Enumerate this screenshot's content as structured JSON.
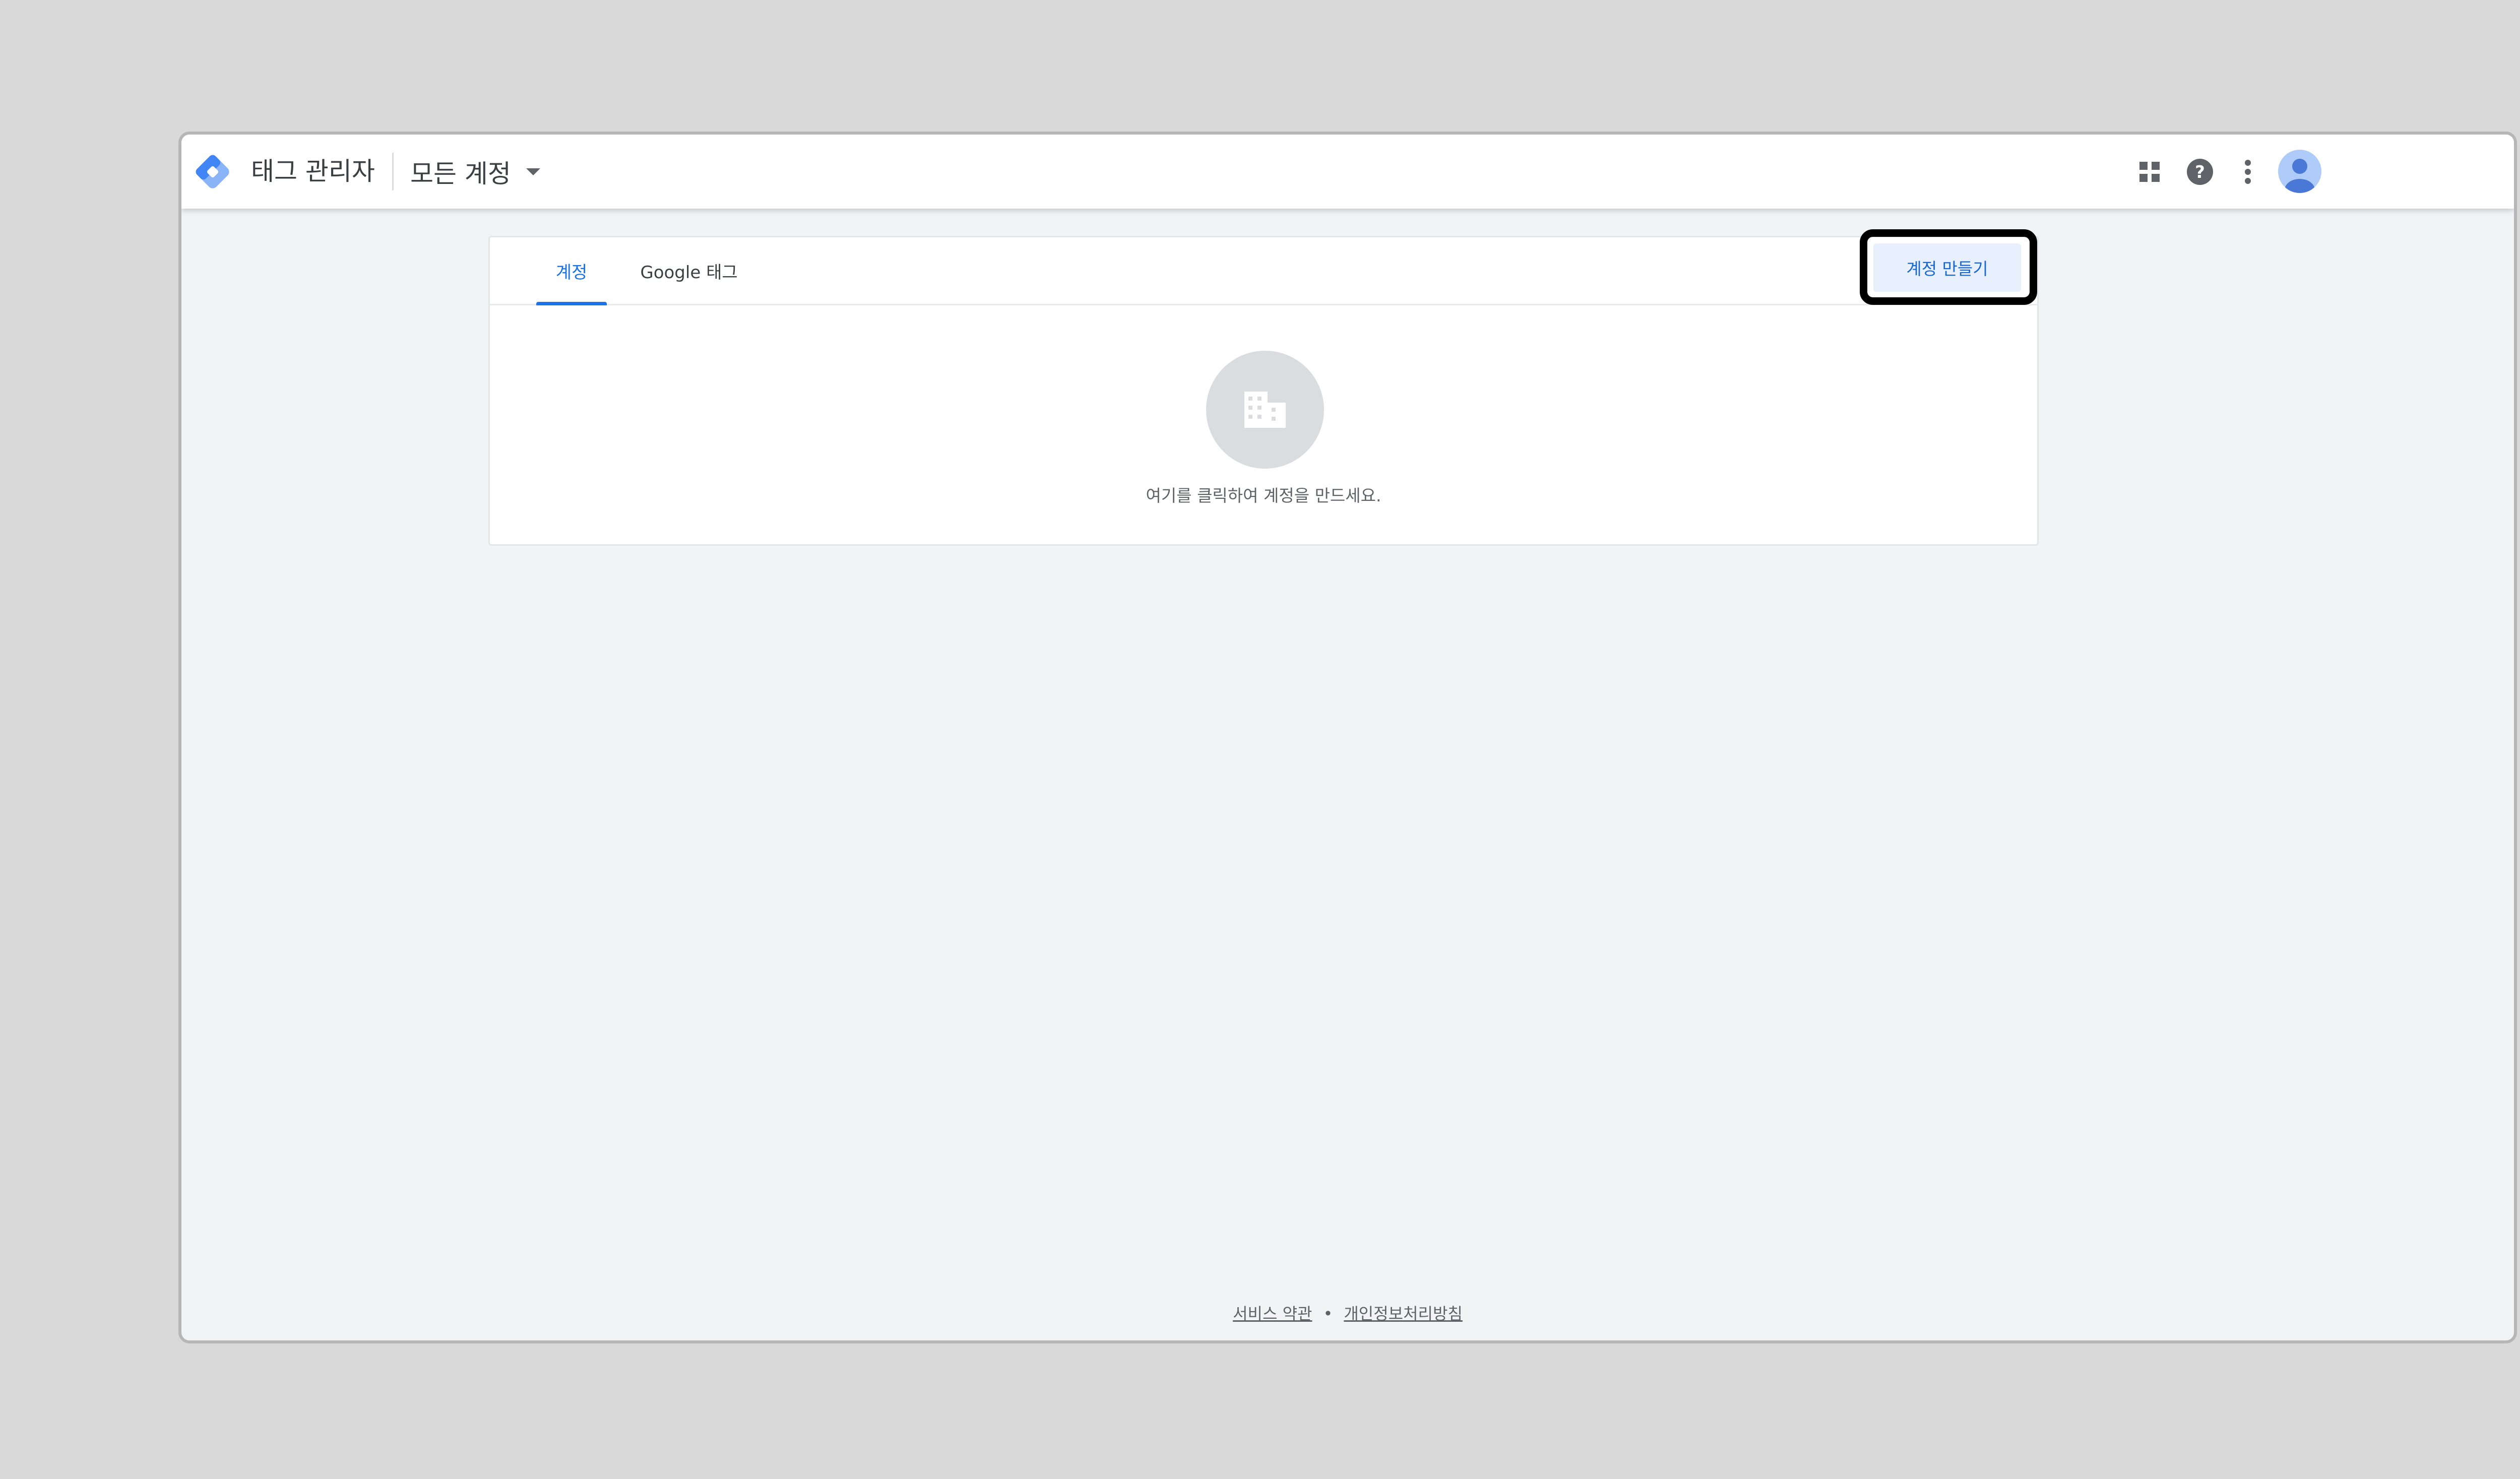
{
  "header": {
    "app_title": "태그 관리자",
    "account_switcher_label": "모든 계정"
  },
  "tabs": [
    {
      "label": "계정",
      "active": true
    },
    {
      "label": "Google 태그",
      "active": false
    }
  ],
  "create_account_button": "계정 만들기",
  "empty_state": {
    "message": "여기를 클릭하여 계정을 만드세요."
  },
  "footer": {
    "terms_link": "서비스 약관",
    "separator": "•",
    "privacy_link": "개인정보처리방침"
  },
  "colors": {
    "accent": "#1a73e8",
    "button_bg": "#e8f0fe",
    "page_bg": "#f1f3f4"
  },
  "icons": [
    "tag-manager-logo-icon",
    "dropdown-caret-icon",
    "apps-grid-icon",
    "help-icon",
    "more-vert-icon",
    "avatar-icon",
    "building-icon"
  ]
}
